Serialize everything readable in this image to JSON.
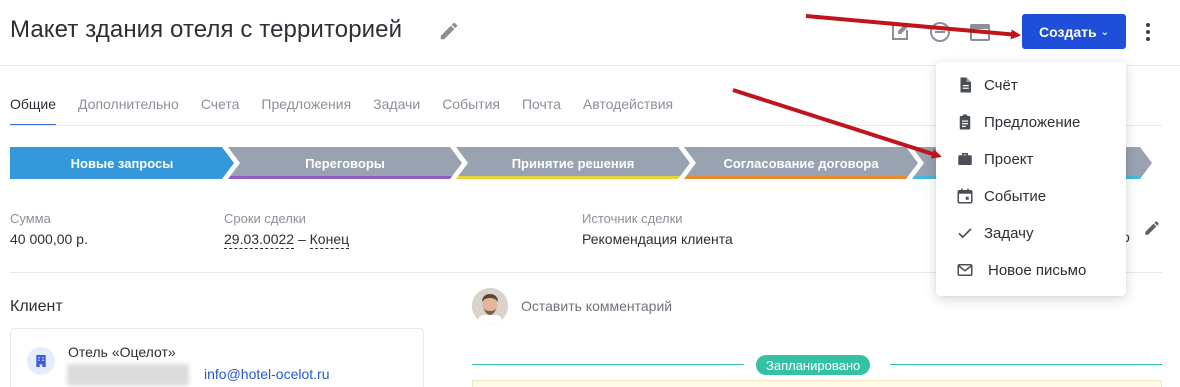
{
  "header": {
    "title": "Макет здания отеля с территорией",
    "create_label": "Создать"
  },
  "tabs": [
    {
      "label": "Общие",
      "active": true
    },
    {
      "label": "Дополнительно"
    },
    {
      "label": "Счета"
    },
    {
      "label": "Предложения"
    },
    {
      "label": "Задачи"
    },
    {
      "label": "События"
    },
    {
      "label": "Почта"
    },
    {
      "label": "Автодействия"
    }
  ],
  "stages": [
    {
      "label": "Новые запросы",
      "color": "#3498db",
      "accent": "#3498db"
    },
    {
      "label": "Переговоры",
      "color": "#98a2b0",
      "accent": "#8e5cc2"
    },
    {
      "label": "Принятие решения",
      "color": "#98a2b0",
      "accent": "#e5d43a"
    },
    {
      "label": "Согласование договора",
      "color": "#98a2b0",
      "accent": "#e58a2e"
    },
    {
      "label": "",
      "color": "#98a2b0",
      "accent": "#44b8d6"
    }
  ],
  "info": {
    "sum_label": "Сумма",
    "sum_value": "40 000,00 р.",
    "dates_label": "Сроки сделки",
    "date_start": "29.03.0022",
    "date_sep": "–",
    "date_end": "Конец",
    "source_label": "Источник сделки",
    "source_value": "Рекомендация клиента",
    "truncated_text": "о"
  },
  "client": {
    "heading": "Клиент",
    "name": "Отель «Оцелот»",
    "email": "info@hotel-ocelot.ru"
  },
  "comment": {
    "placeholder": "Оставить комментарий"
  },
  "planned": {
    "label": "Запланировано"
  },
  "create_menu": {
    "items": [
      {
        "label": "Счёт",
        "icon": "invoice-icon"
      },
      {
        "label": "Предложение",
        "icon": "clipboard-icon"
      },
      {
        "label": "Проект",
        "icon": "briefcase-icon"
      },
      {
        "label": "Событие",
        "icon": "calendar-icon"
      },
      {
        "label": "Задачу",
        "icon": "check-icon"
      },
      {
        "label": "Новое письмо",
        "icon": "mail-icon"
      }
    ]
  },
  "colors": {
    "primary": "#1f4fd8",
    "arrow": "#c0141b",
    "planned": "#35c2a4"
  }
}
